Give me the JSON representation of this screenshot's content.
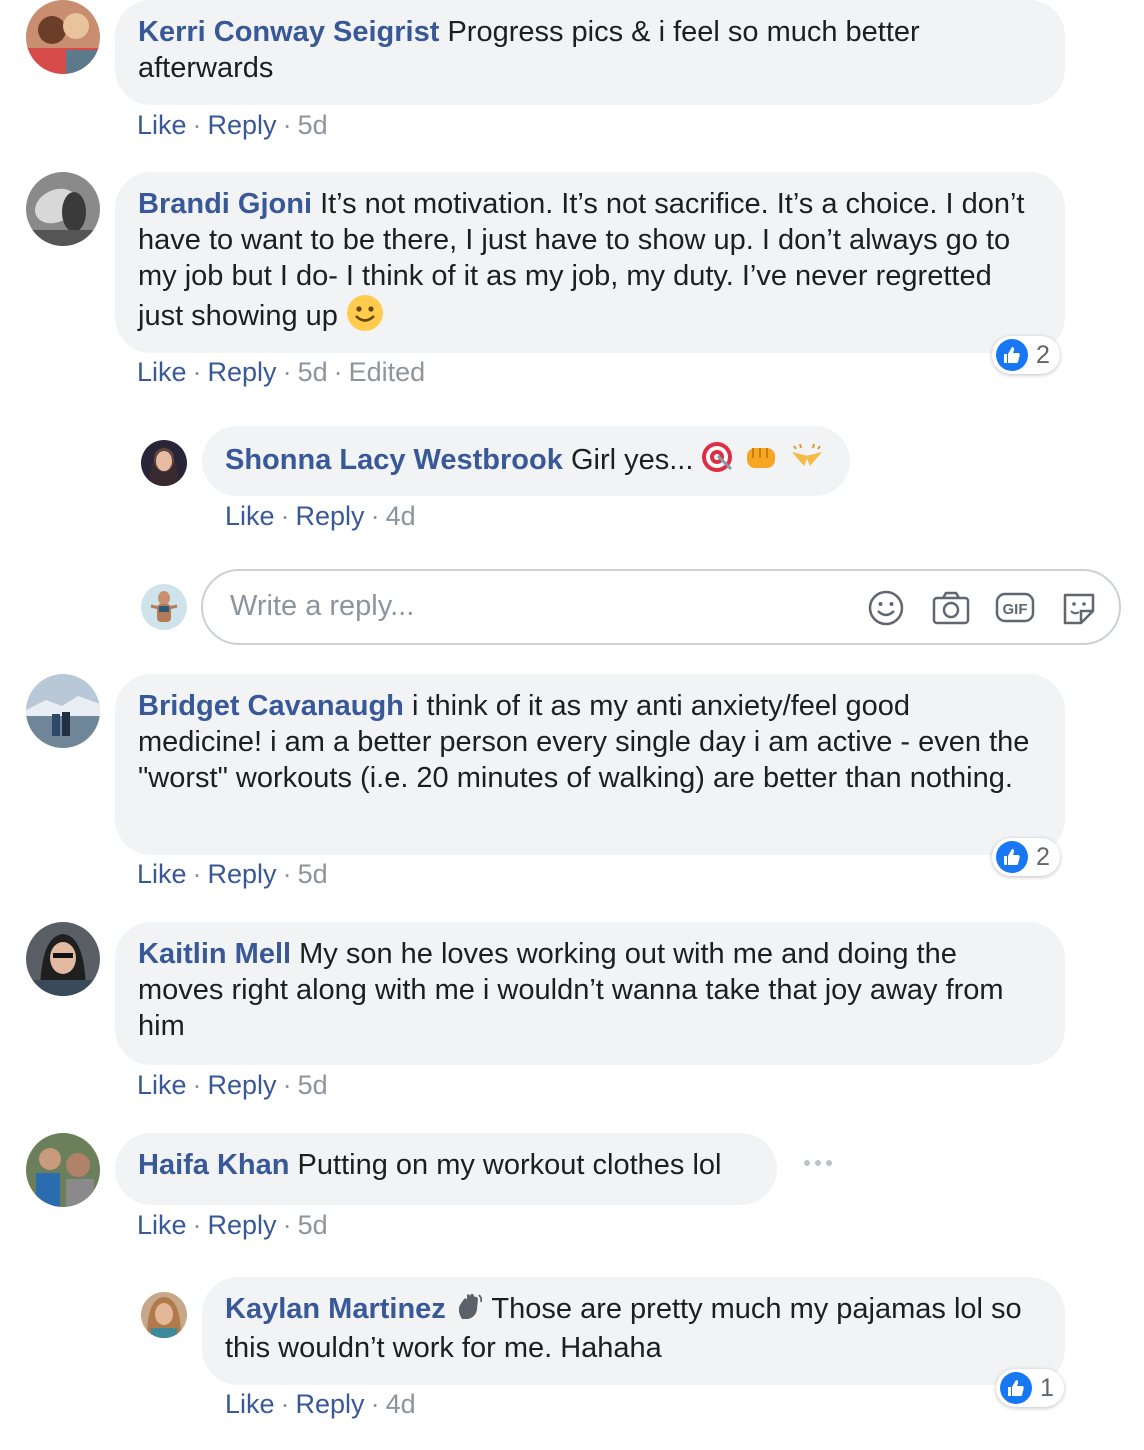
{
  "comments": [
    {
      "author": "Kerri Conway Seigrist",
      "text": "Progress pics & i feel so much better afterwards",
      "actions": {
        "like": "Like",
        "reply": "Reply",
        "time": "5d"
      }
    },
    {
      "author": "Brandi Gjoni",
      "text": "It’s not motivation. It’s not sacrifice. It’s a choice. I don’t have to want to be there, I just have to show up. I don’t always go to my job but I do- I think of it as my job, my duty. I’ve never regretted just showing up",
      "actions": {
        "like": "Like",
        "reply": "Reply",
        "time": "5d",
        "edited": "Edited"
      },
      "reactions": "2"
    },
    {
      "author": "Shonna Lacy Westbrook",
      "text": "Girl yes...",
      "actions": {
        "like": "Like",
        "reply": "Reply",
        "time": "4d"
      }
    },
    {
      "author": "Bridget Cavanaugh",
      "text": "i think of it as my anti anxiety/feel good medicine! i am a better person every single day i am active - even the \"worst\" workouts (i.e. 20 minutes of walking) are better than nothing.",
      "actions": {
        "like": "Like",
        "reply": "Reply",
        "time": "5d"
      },
      "reactions": "2"
    },
    {
      "author": "Kaitlin Mell",
      "text": "My son he loves working out with me and doing the moves right along with me i wouldn’t wanna take that joy away from him",
      "actions": {
        "like": "Like",
        "reply": "Reply",
        "time": "5d"
      }
    },
    {
      "author": "Haifa Khan",
      "text": "Putting on my workout clothes lol",
      "actions": {
        "like": "Like",
        "reply": "Reply",
        "time": "5d"
      }
    },
    {
      "author": "Kaylan Martinez",
      "text": "Those are pretty much my pajamas lol so this wouldn’t work for me. Hahaha",
      "actions": {
        "like": "Like",
        "reply": "Reply",
        "time": "4d"
      },
      "reactions": "1"
    }
  ],
  "reply_box": {
    "placeholder": "Write a reply..."
  },
  "icons": [
    "smiley-emoji-icon",
    "bullseye-emoji-icon",
    "fist-emoji-icon",
    "clapping-emoji-icon",
    "emoji-icon",
    "camera-icon",
    "gif-icon",
    "sticker-icon",
    "more-options-icon",
    "waving-hand-icon",
    "like-icon"
  ],
  "colors": {
    "author": "#385898",
    "bubble": "#f2f3f5",
    "meta": "#8d949e",
    "like_blue": "#1877f2"
  }
}
